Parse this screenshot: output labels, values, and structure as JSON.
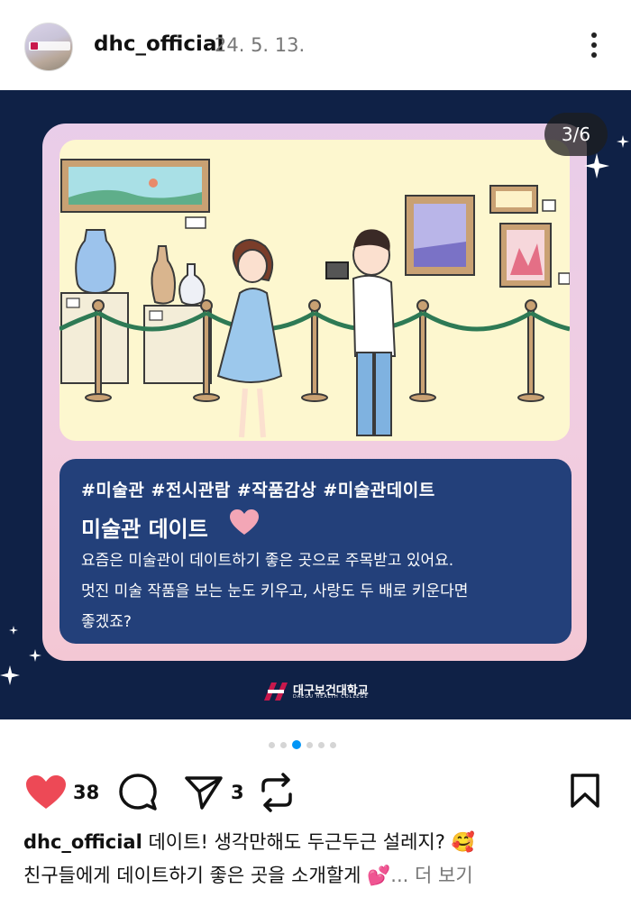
{
  "post_header": {
    "username": "dhc_official",
    "date": "24. 5. 13.",
    "avatar_caption": "대구보건대학교"
  },
  "post_image": {
    "page_indicator": "3/6",
    "hashtags": "#미술관 #전시관람 #작품감상 #미술관데이트",
    "card_title": "미술관 데이트",
    "card_body_lines": [
      "요즘은 미술관이 데이트하기 좋은 곳으로 주목받고 있어요.",
      "멋진 미술 작품을 보는 눈도 키우고, 사랑도 두 배로 키운다면",
      "좋겠죠?"
    ],
    "brand_name": "대구보건대학교",
    "brand_english": "DAEGU HEALTH COLLEGE"
  },
  "carousel": {
    "total": 6,
    "active_index": 2,
    "visible_dots": 6
  },
  "actions": {
    "like_count": "38",
    "share_count": "3",
    "icons": [
      "heart-icon",
      "comment-icon",
      "send-icon",
      "repost-icon",
      "bookmark-icon"
    ],
    "like_color": "#ed4956"
  },
  "caption": {
    "username": "dhc_official",
    "line1": "데이트! 생각만해도 두근두근 설레지? 🥰",
    "line2": "친구들에게 데이트하기 좋은 곳을 소개할게 💕",
    "ellipsis": "...",
    "see_more": "더 보기"
  },
  "colors": {
    "post_background": "#0f2146",
    "text_card": "#23407a",
    "frame_pink": "#f1cde0",
    "accent_blue": "#0095f6"
  }
}
